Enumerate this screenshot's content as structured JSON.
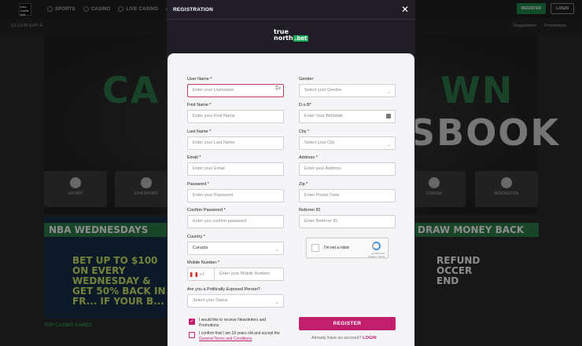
{
  "site": {
    "logo_text": "true north bet",
    "nav": [
      {
        "icon": "sports-icon",
        "label": "SPORTS"
      },
      {
        "icon": "casino-icon",
        "label": "CASINO"
      },
      {
        "icon": "live-casino-icon",
        "label": "LIVE CASINO"
      },
      {
        "icon": "games-icon",
        "label": ""
      }
    ],
    "register_label": "REGISTER",
    "login_label": "LOGIN",
    "time": "13:13:48 GMT-4",
    "regulations": "Regulations",
    "promotions": "Promotions",
    "hero_line1": "CA",
    "hero_line1_right": "WN",
    "hero_line2": "SBOOK",
    "tiles": [
      {
        "icon": "sport-icon",
        "label": "SPORT"
      },
      {
        "icon": "livesport-icon",
        "label": "LIVESPORT"
      },
      {
        "icon": "crash-icon",
        "label": "CRASH"
      },
      {
        "icon": "rocketon-icon",
        "label": "ROCKETON"
      }
    ],
    "promo_left_band": "NBA WEDNESDAYS",
    "promo_left_body": "BET UP TO $100 ON EVERY WEDNESDAY & GET 50% BACK IN FR... IF YOUR B...",
    "promo_right_band": "DRAW MONEY BACK",
    "promo_right_body": "REFUND OCCER END",
    "top_casino_games": "TOP CASINO GAMES"
  },
  "modal": {
    "title": "REGISTRATION",
    "close_symbol": "✕",
    "brand_line1": "true",
    "brand_line2": "north",
    "brand_bet": ".bet",
    "fields_left": [
      {
        "label": "User Name *",
        "placeholder": "Enter your Username",
        "type": "text"
      },
      {
        "label": "First Name *",
        "placeholder": "Enter your First Name",
        "type": "text"
      },
      {
        "label": "Last Name *",
        "placeholder": "Enter your Last Name",
        "type": "text"
      },
      {
        "label": "Email *",
        "placeholder": "Enter your Email",
        "type": "text"
      },
      {
        "label": "Password *",
        "placeholder": "Enter your Password",
        "type": "text"
      },
      {
        "label": "Confirm Password *",
        "placeholder": "Enter you confirm password",
        "type": "text"
      },
      {
        "label": "Country *",
        "value": "Canada",
        "type": "select"
      }
    ],
    "fields_right": [
      {
        "label": "Gender",
        "placeholder": "Select your Gender",
        "type": "select"
      },
      {
        "label": "D.o.B*",
        "placeholder": "Enter Your Birthdate",
        "type": "date"
      },
      {
        "label": "City *",
        "placeholder": "Select your City",
        "type": "select"
      },
      {
        "label": "Address *",
        "placeholder": "Enter your Address",
        "type": "text"
      },
      {
        "label": "Zip *",
        "placeholder": "Enter Postal Code",
        "type": "text"
      },
      {
        "label": "Referrer ID",
        "placeholder": "Enter Referrer ID",
        "type": "text"
      }
    ],
    "mobile": {
      "label": "Mobile Number *",
      "prefix": "+1",
      "placeholder": "Enter your Mobile Number"
    },
    "pep": {
      "label": "Are you a Politically Exposed Person?",
      "placeholder": "Select your Status"
    },
    "captcha": {
      "text": "I'm not a robot",
      "brand": "reCAPTCHA",
      "terms": "Privacy - Terms"
    },
    "newsletter": {
      "text": "I would like to receive Newsletters and Promotions",
      "checked": true
    },
    "terms": {
      "text": "I confirm that I am 19 years old and accept the",
      "link": "General Terms and Conditions",
      "checked": false
    },
    "register_button": "REGISTER",
    "login_prompt": "Already have an account?",
    "login_link": "LOGIN"
  }
}
